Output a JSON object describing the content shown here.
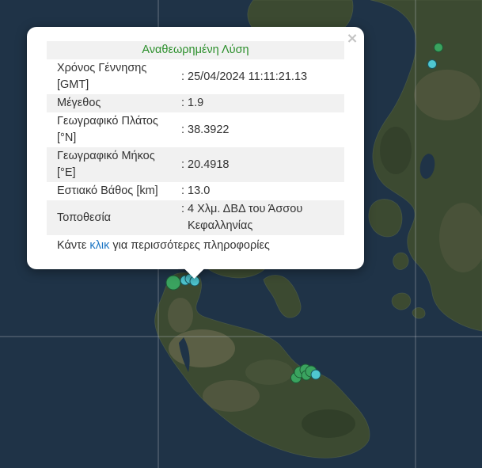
{
  "popup": {
    "title": "Αναθεωρημένη Λύση",
    "separator": ":",
    "rows": [
      {
        "label": "Χρόνος Γέννησης [GMT]",
        "value": "25/04/2024 11:11:21.13"
      },
      {
        "label": "Μέγεθος",
        "value": "1.9"
      },
      {
        "label": "Γεωγραφικό Πλάτος [°N]",
        "value": "38.3922"
      },
      {
        "label": "Γεωγραφικό Μήκος [°E]",
        "value": "20.4918"
      },
      {
        "label": "Εστιακό Βάθος [km]",
        "value": "13.0"
      },
      {
        "label": "Τοποθεσία",
        "value": "4 Χλμ. ΔΒΔ του Άσσου Κεφαλληνίας"
      }
    ],
    "footer": {
      "before": "Κάντε",
      "link": "κλικ",
      "after": "για περισσότερες πληροφορίες"
    },
    "close_symbol": "×"
  },
  "icons": {
    "close": "close-icon",
    "marker": "circle-marker-icon"
  },
  "colors": {
    "title": "#2b8f2b",
    "link": "#1b75c4",
    "text": "#333333",
    "row_alt": "#f1f1f1",
    "marker_green": "#3aa35f",
    "marker_cyan": "#4fc7d1",
    "sea": "#1f3347",
    "land": "#3c4a31"
  }
}
